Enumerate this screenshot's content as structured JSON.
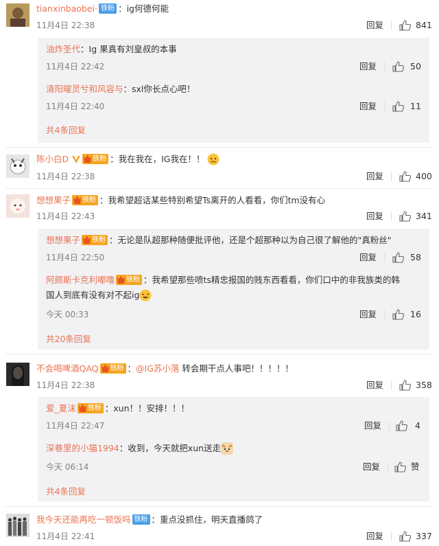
{
  "comments": [
    {
      "user": "tianxinbaobei·",
      "badge": "铁粉",
      "text": "：ig何德何能",
      "time": "11月4日 22:38",
      "reply_label": "回复",
      "likes": "841",
      "replies": [
        {
          "user": "油炸圣代",
          "text": "：Ig 果真有刘皇叔的本事",
          "time": "11月4日 22:42",
          "reply_label": "回复",
          "likes": "50"
        },
        {
          "user": "清阳曜灵兮和风容与",
          "text": "：sxl你长点心吧！",
          "time": "11月4日 22:40",
          "reply_label": "回复",
          "likes": "11"
        }
      ],
      "more": "共4条回复"
    },
    {
      "user": "陈小白D",
      "badge": "铁粉",
      "text": "：我在我在，IG我在！！",
      "time": "11月4日 22:38",
      "reply_label": "回复",
      "likes": "400"
    },
    {
      "user": "想想果子",
      "badge": "铁粉",
      "text": "：我希望超话某些特别希望Ts离开的人看看，你们tm没有心",
      "time": "11月4日 22:43",
      "reply_label": "回复",
      "likes": "341",
      "replies": [
        {
          "user": "想想果子",
          "badge": "铁粉",
          "text": "：无论是队超那种随便批评他，还是个超那种以为自己很了解他的\"真粉丝\"",
          "time": "11月4日 22:50",
          "reply_label": "回复",
          "likes": "58"
        },
        {
          "user": "阿颇斯卡克利嘟噜",
          "badge": "铁粉",
          "text": "：我希望那些喷ts精忠报国的贱东西看看，你们口中的非我族类的韩",
          "text2": "国人到底有没有对不起ig",
          "time": "今天 00:33",
          "reply_label": "回复",
          "likes": "16"
        }
      ],
      "more": "共20条回复"
    },
    {
      "user": "不会喝啤酒QAQ",
      "badge": "铁粉",
      "mention": "@IG苏小落",
      "text": " 转会期干点人事吧！！！！！",
      "time": "11月4日 22:38",
      "reply_label": "回复",
      "likes": "358",
      "replies": [
        {
          "user": "爱_夏沫",
          "badge": "铁粉",
          "text": "：xun！！安排！！！",
          "time": "11月4日 22:47",
          "reply_label": "回复",
          "likes": "4"
        },
        {
          "user": "深巷里的小猫1994",
          "text": "：收到，今天就把xun送走",
          "time": "今天 06:14",
          "reply_label": "回复",
          "likes": "赞"
        }
      ],
      "more": "共4条回复"
    },
    {
      "user": "我今天还能再吃一顿饭吗",
      "badge": "铁粉",
      "text": "：重点没抓住，明天直播鸽了",
      "time": "11月4日 22:41",
      "reply_label": "回复",
      "likes": "337"
    }
  ],
  "colors": {
    "username": "#eb7350",
    "badge_blue": "#4d9fe8",
    "badge_gold": "#f5a623",
    "reply_bg": "#f2f2f5"
  }
}
